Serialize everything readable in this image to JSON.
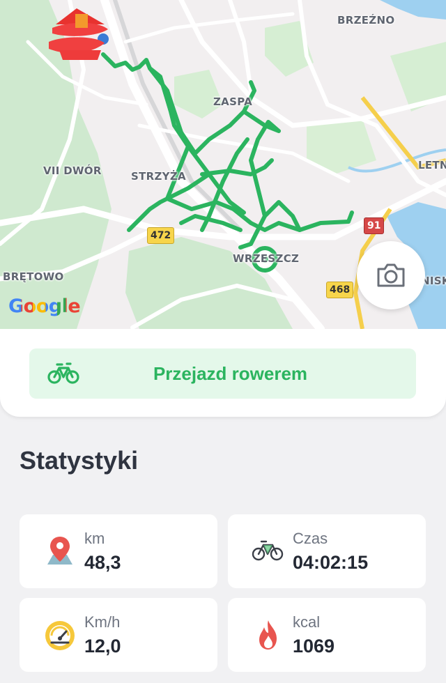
{
  "map": {
    "place_labels": [
      "BRZEŹNO",
      "ZASPA",
      "VII DWÓR",
      "STRZYŻA",
      "LETN",
      "BRĘTOWO",
      "WRZESZCZ",
      "NISK"
    ],
    "road_shields": [
      {
        "label": "472",
        "color": "yellow"
      },
      {
        "label": "91",
        "color": "red"
      },
      {
        "label": "468",
        "color": "yellow"
      }
    ],
    "attribution": "Google",
    "route_color": "#2bb45f",
    "camera_button_icon": "camera-icon"
  },
  "activity_button": {
    "label": "Przejazd rowerem",
    "icon": "bike-icon",
    "accent": "#2bb45f"
  },
  "stats": {
    "title": "Statystyki",
    "cards": [
      {
        "label": "km",
        "value": "48,3",
        "icon": "map-pin-icon"
      },
      {
        "label": "Czas",
        "value": "04:02:15",
        "icon": "bike-icon"
      },
      {
        "label": "Km/h",
        "value": "12,0",
        "icon": "speedometer-icon"
      },
      {
        "label": "kcal",
        "value": "1069",
        "icon": "flame-icon"
      }
    ]
  }
}
